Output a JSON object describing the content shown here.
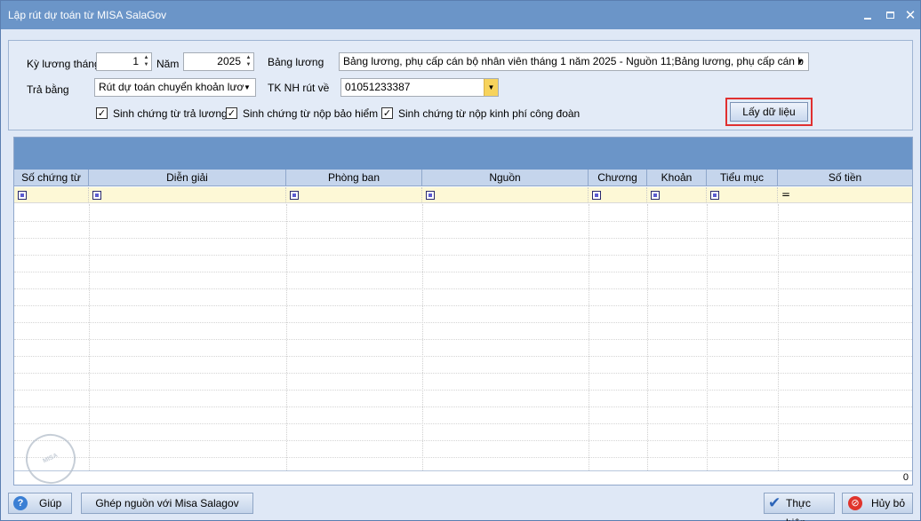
{
  "window": {
    "title": "Lập rút dự toán từ MISA SalaGov",
    "min_icon": "minimize-icon",
    "max_icon": "maximize-icon",
    "close_icon": "close-icon",
    "close_glyph": "✕"
  },
  "form": {
    "ky_luong_label": "Kỳ lương tháng",
    "ky_luong_value": "1",
    "nam_label": "Năm",
    "nam_value": "2025",
    "bang_luong_label": "Bảng lương",
    "bang_luong_value": "Bảng lương, phụ cấp cán bộ nhân viên tháng 1 năm 2025 - Nguồn 11;Bảng lương, phụ cấp cán b",
    "tra_bang_label": "Trả bằng",
    "tra_bang_value": "Rút dự toán chuyển khoản lươ",
    "tk_nh_label": "TK NH rút về",
    "tk_nh_value": "01051233387",
    "checkboxes": [
      {
        "label": "Sinh chứng từ trả lương",
        "checked": true
      },
      {
        "label": "Sinh chứng từ nộp bảo hiểm",
        "checked": true
      },
      {
        "label": "Sinh chứng từ nộp kinh phí công đoàn",
        "checked": true
      }
    ],
    "check_glyph": "✓",
    "fetch_button": "Lấy dữ liệu"
  },
  "grid": {
    "columns": [
      "Số chứng từ",
      "Diễn giải",
      "Phòng ban",
      "Nguồn",
      "Chương",
      "Khoản",
      "Tiểu mục",
      "Số tiền"
    ],
    "filter_eq": "=",
    "rows": [],
    "total": "0"
  },
  "footer": {
    "help_label": "Giúp",
    "help_glyph": "?",
    "merge_label": "Ghép nguồn với Misa Salagov",
    "execute_label": "Thực hiện",
    "execute_glyph": "✔",
    "cancel_label": "Hủy bỏ",
    "cancel_glyph": "⊘"
  },
  "colors": {
    "title_bar": "#6b95c8",
    "window_bg": "#dfe8f6",
    "highlight_border": "#e03030",
    "filter_row": "#fdf8d6"
  }
}
